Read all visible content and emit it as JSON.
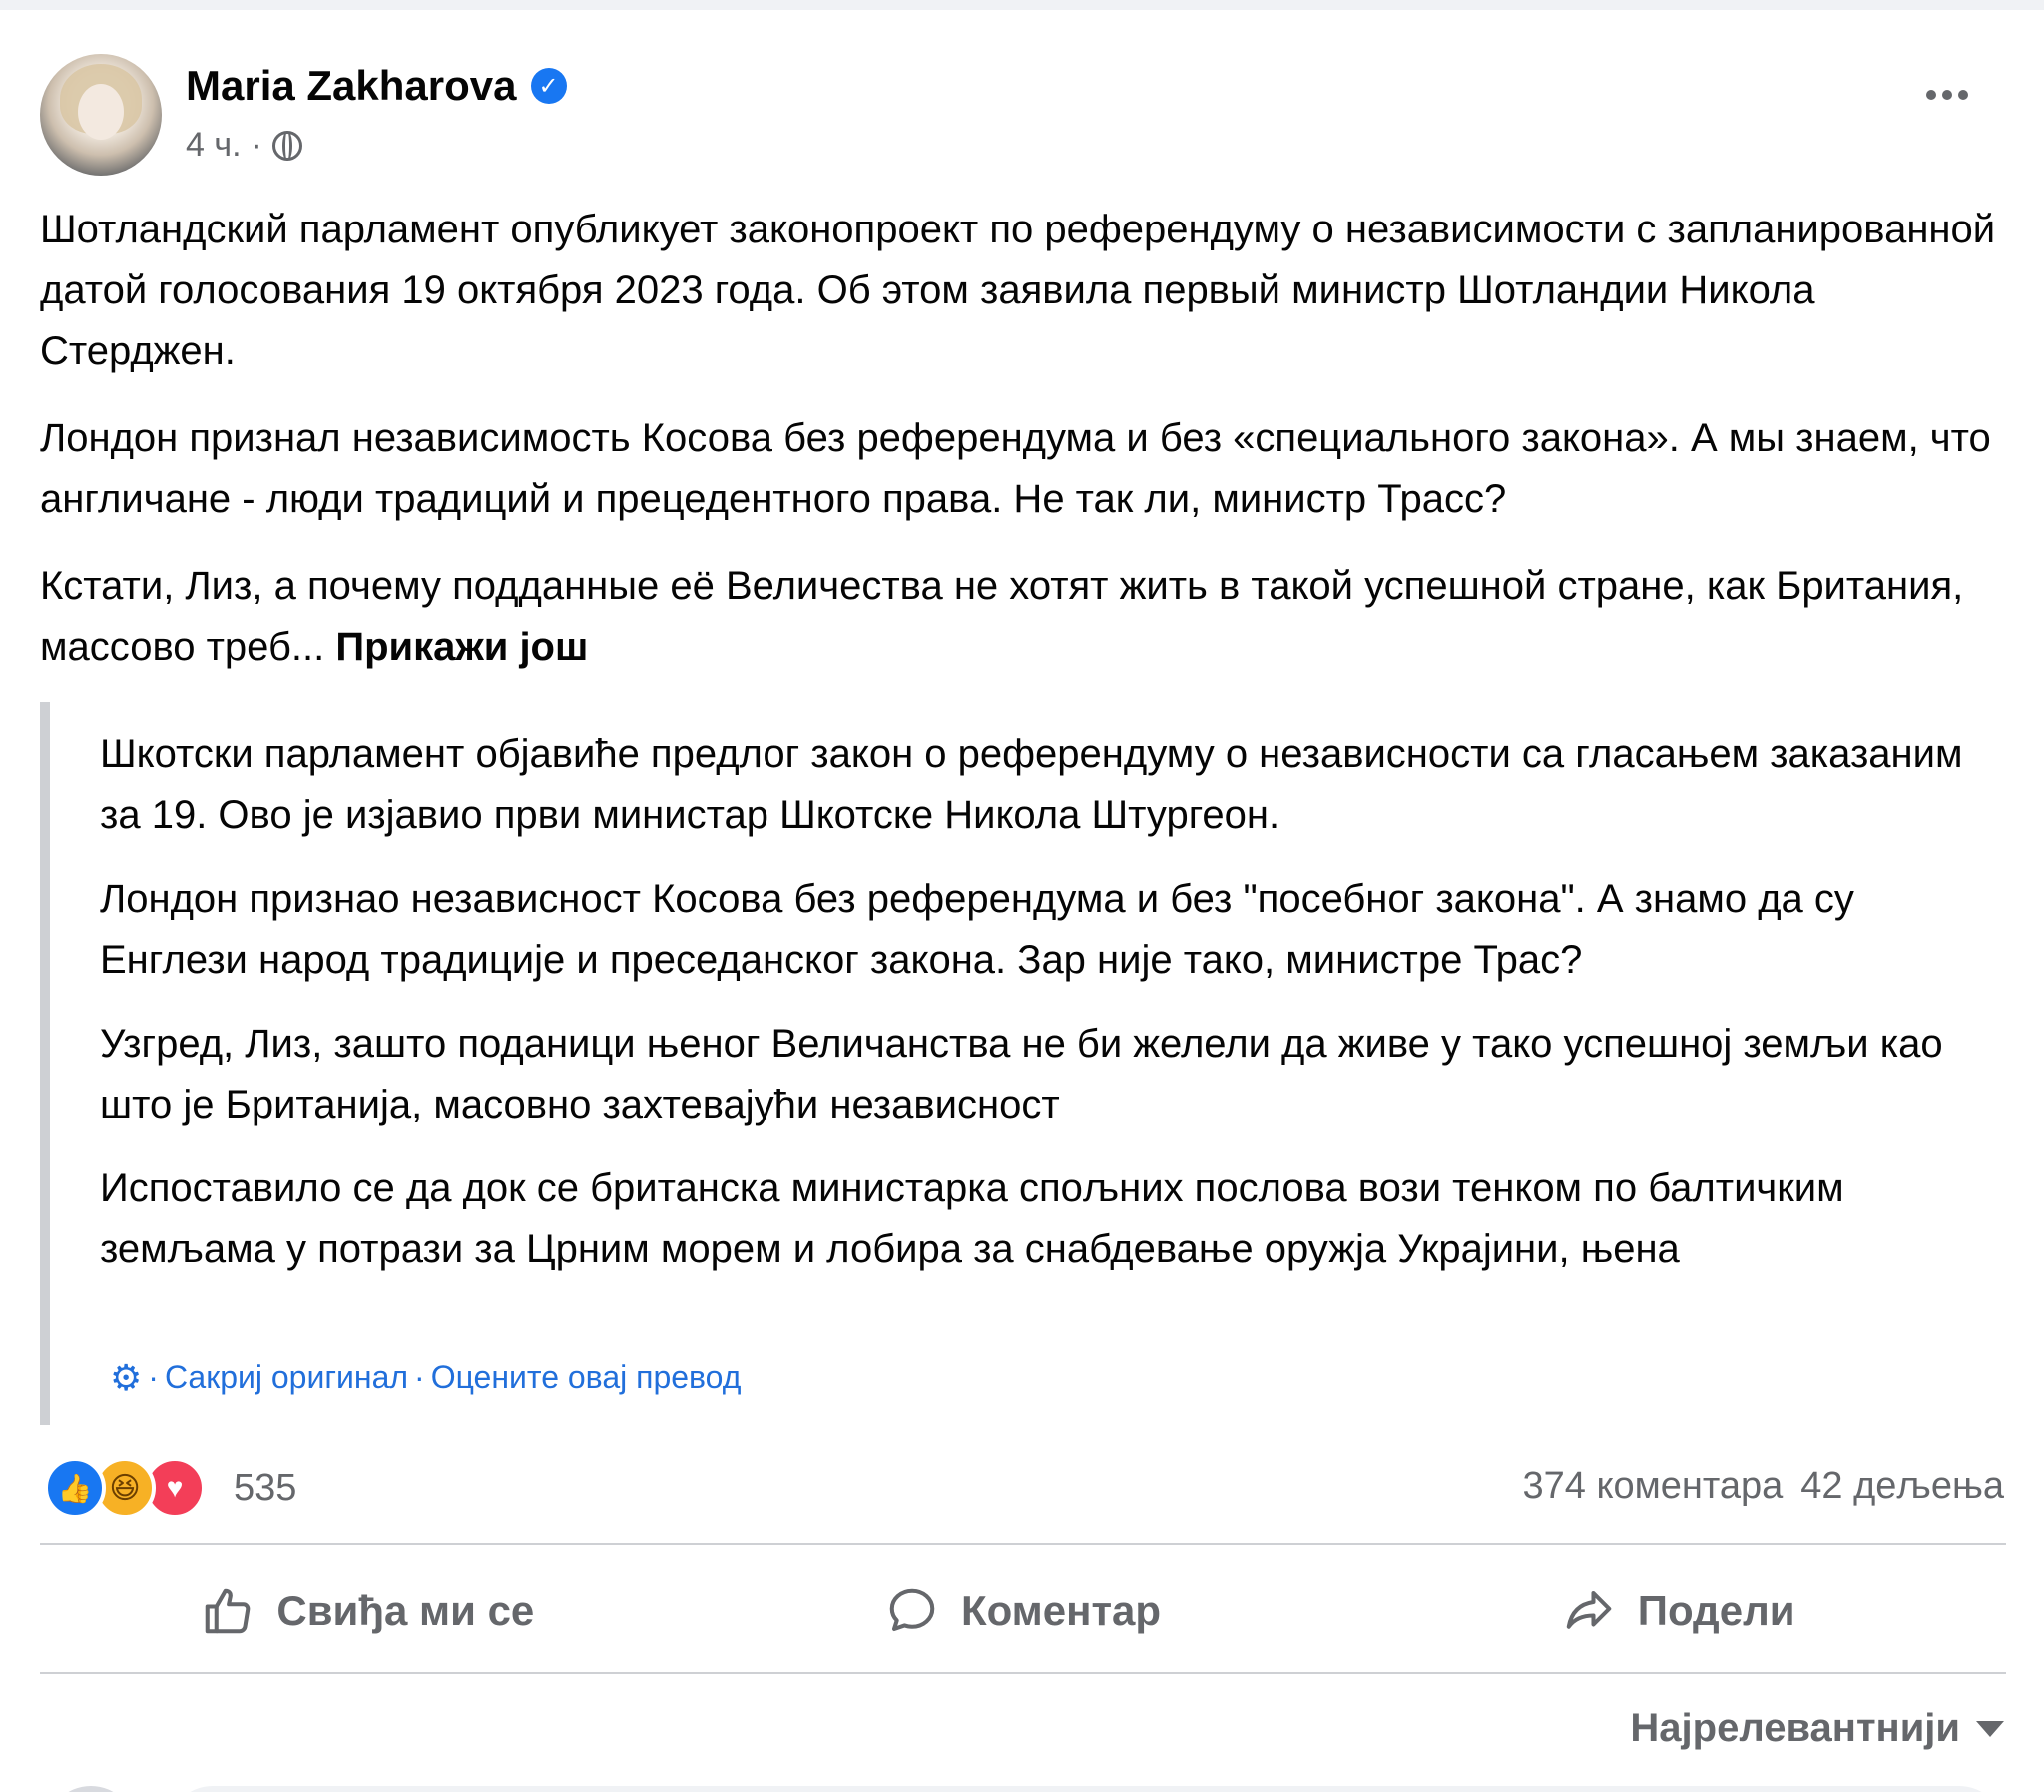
{
  "post": {
    "author": "Maria Zakharova",
    "time": "4 ч.",
    "dot": "·",
    "paragraphs": [
      "Шотландский парламент опубликует законопроект по референдуму о независимости с запланированной датой голосования 19 октября 2023 года. Об этом заявила первый министр Шотландии Никола Стерджен.",
      "Лондон признал независимость Косова без референдума и без «специального закона». А мы знаем, что англичане - люди традиций и прецедентного права. Не так ли, министр Трасс?"
    ],
    "truncated_paragraph": "Кстати, Лиз, а почему подданные её Величества  не хотят жить в такой успешной стране, как Британия, массово треб...",
    "see_more": "Прикажи још"
  },
  "translation": {
    "paragraphs": [
      "Шкотски парламент објавиће предлог закон о референдуму о независности са гласањем заказаним за 19. Ово је изјавио први министар Шкотске Никола Штургеон.",
      "Лондон признао независност Косова без референдума и без \"посебног закона\". А знамо да су Енглези народ традиције и преседанског закона. Зар није тако, министре Трас?",
      "Узгред, Лиз, зашто поданици њеног Величанства не би желели да живе у тако успешној земљи као што је Британија, масовно захтевајући независност",
      "Испоставило се да док се британска министарка спољних послова вози тенком по балтичким земљама у потрази за Црним морем и лобира за снабдевање оружја Украјини, њена"
    ],
    "hide_original": "Сакриј оригинал",
    "rate_translation": "Оцените овај превод",
    "separator": "·"
  },
  "stats": {
    "reaction_count": "535",
    "comments": "374 коментара",
    "shares": "42 дељења"
  },
  "actions": {
    "like": "Свиђа ми се",
    "comment": "Коментар",
    "share": "Подели"
  },
  "comments": {
    "sort_label": "Најрелевантнији"
  },
  "colors": {
    "accent": "#1877f2",
    "link": "#216fdb",
    "secondary_text": "#65676b",
    "love": "#f33e58",
    "haha": "#f7b125"
  }
}
